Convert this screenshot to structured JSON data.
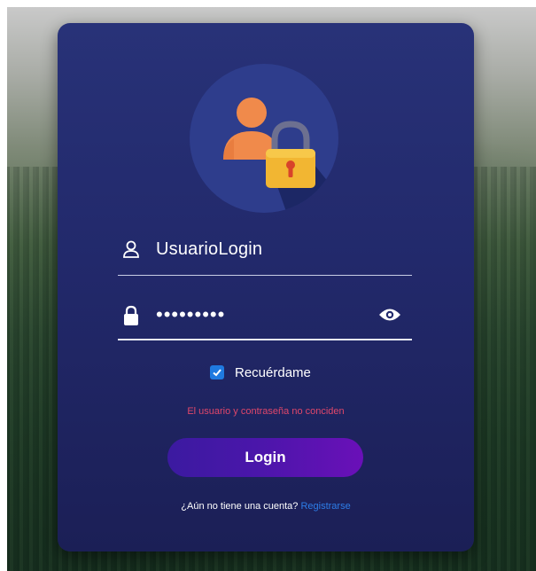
{
  "colors": {
    "card_bg": "#242c6e",
    "avatar_circle": "#2e3d8c",
    "accent_button": "#4a16aa",
    "error_text": "#e0476a",
    "link": "#2d7de8",
    "checkbox": "#1f7ae0"
  },
  "icons": {
    "avatar": "user-lock-icon",
    "username": "user-icon",
    "password": "lock-icon",
    "visibility": "eye-icon",
    "checkbox": "check-icon"
  },
  "form": {
    "username_value": "UsuarioLogin",
    "password_value": "•••••••••",
    "remember_label": "Recuérdame",
    "remember_checked": true,
    "error_message": "El usuario y contraseña no conciden",
    "login_label": "Login"
  },
  "footer": {
    "prompt": "¿Aún no tiene una cuenta?",
    "register_link": "Registrarse"
  }
}
